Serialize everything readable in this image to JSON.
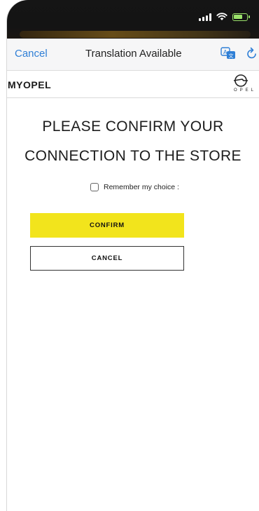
{
  "nav": {
    "cancel_label": "Cancel",
    "title": "Translation Available",
    "translate_icon": "translate-icon",
    "reload_icon": "reload-icon",
    "link_color": "#2f7fd6"
  },
  "site": {
    "brand": "MYOPEL",
    "logo_wordmark": "OPEL"
  },
  "dialog": {
    "heading_line1": "PLEASE CONFIRM YOUR",
    "heading_line2": "CONNECTION TO THE STORE",
    "remember_label": "Remember my choice :",
    "remember_checked": false,
    "confirm_label": "CONFIRM",
    "cancel_label": "CANCEL",
    "accent_color": "#f2e41c"
  }
}
